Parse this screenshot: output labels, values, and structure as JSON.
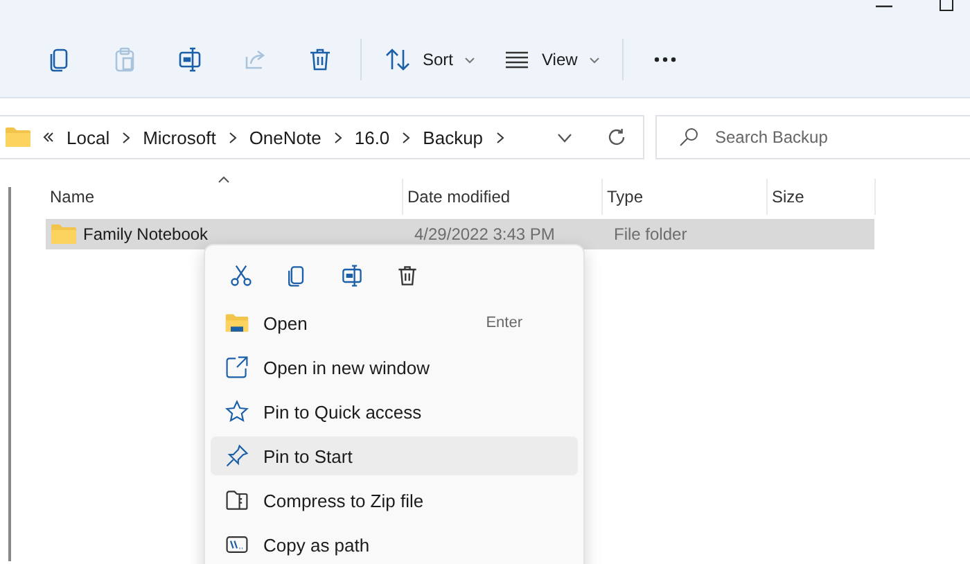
{
  "toolbar": {
    "buttons": [
      {
        "kind": "copy",
        "disabled": false
      },
      {
        "kind": "paste",
        "disabled": true
      },
      {
        "kind": "rename",
        "disabled": false
      },
      {
        "kind": "share",
        "disabled": true
      },
      {
        "kind": "delete",
        "disabled": false
      }
    ],
    "menus": [
      {
        "kind": "sort",
        "label": "Sort"
      },
      {
        "kind": "view",
        "label": "View"
      }
    ]
  },
  "address": {
    "path": [
      "Local",
      "Microsoft",
      "OneNote",
      "16.0",
      "Backup"
    ]
  },
  "search": {
    "placeholder": "Search Backup"
  },
  "columns": [
    {
      "label": "Name",
      "sorted": true
    },
    {
      "label": "Date modified",
      "sorted": false
    },
    {
      "label": "Type",
      "sorted": false
    },
    {
      "label": "Size",
      "sorted": false
    }
  ],
  "files": [
    {
      "name": "Family Notebook",
      "date": "4/29/2022 3:43 PM",
      "type": "File folder",
      "selected": true
    }
  ],
  "context_menu": {
    "quick_actions": [
      {
        "kind": "cut"
      },
      {
        "kind": "copy"
      },
      {
        "kind": "rename"
      },
      {
        "kind": "delete"
      }
    ],
    "items": [
      {
        "kind": "open",
        "label": "Open",
        "shortcut": "Enter",
        "selected": false
      },
      {
        "kind": "new-window",
        "label": "Open in new window",
        "selected": false
      },
      {
        "kind": "star",
        "label": "Pin to Quick access",
        "selected": false
      },
      {
        "kind": "pin",
        "label": "Pin to Start",
        "selected": true
      },
      {
        "kind": "zip",
        "label": "Compress to Zip file",
        "selected": false
      },
      {
        "kind": "path",
        "label": "Copy as path",
        "selected": false
      }
    ]
  }
}
